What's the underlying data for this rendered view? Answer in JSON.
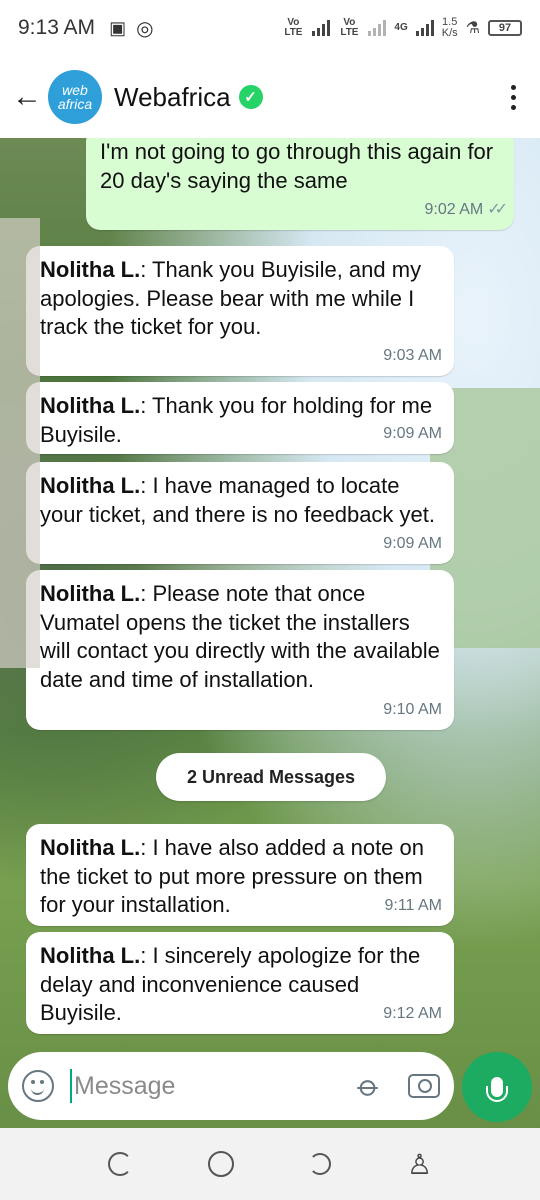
{
  "status_bar": {
    "time": "9:13 AM",
    "net_speed": "1.5",
    "net_speed_unit": "K/s",
    "net_type": "4G",
    "lte_label": "Vo LTE",
    "battery": "97"
  },
  "header": {
    "contact_name": "Webafrica",
    "avatar_line1": "web",
    "avatar_line2": "africa",
    "verified": true
  },
  "messages": [
    {
      "direction": "out",
      "sender": "",
      "text": "I'm not going to go through this again for 20 day's saying the same",
      "time": "9:02 AM",
      "status": "read"
    },
    {
      "direction": "in",
      "sender": "Nolitha L.",
      "text": ": Thank you Buyisile, and my apologies. Please bear with me while I track the ticket for you.",
      "time": "9:03 AM"
    },
    {
      "direction": "in",
      "sender": "Nolitha L.",
      "text": ": Thank you for holding for me Buyisile.",
      "time": "9:09 AM"
    },
    {
      "direction": "in",
      "sender": "Nolitha L.",
      "text": ": I have managed to locate your ticket, and there is no feedback yet.",
      "time": "9:09 AM"
    },
    {
      "direction": "in",
      "sender": "Nolitha L.",
      "text": ": Please note that once Vumatel opens the ticket the installers will contact you directly with the available date and time of installation.",
      "time": "9:10 AM"
    },
    {
      "direction": "in",
      "sender": "Nolitha L.",
      "text": ": I have also added a note on the ticket to put more pressure on them for your installation.",
      "time": "9:11 AM"
    },
    {
      "direction": "in",
      "sender": "Nolitha L.",
      "text": ": I sincerely apologize for the delay and inconvenience caused Buyisile.",
      "time": "9:12 AM"
    }
  ],
  "unread_label": "2 Unread Messages",
  "composer": {
    "placeholder": "Message"
  },
  "icons": {
    "back": "arrow-left-icon",
    "menu": "more-vert-icon",
    "emoji": "emoji-icon",
    "attach": "paperclip-icon",
    "camera": "camera-icon",
    "mic": "mic-icon"
  },
  "colors": {
    "outgoing_bubble": "#d9fdd3",
    "incoming_bubble": "#ffffff",
    "accent": "#1daa61",
    "verified": "#25d366"
  }
}
